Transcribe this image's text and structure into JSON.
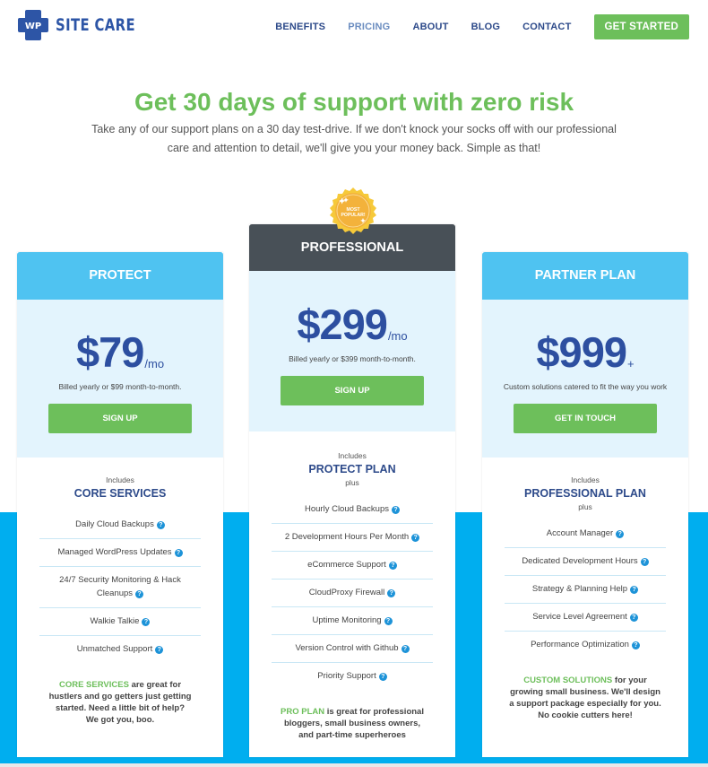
{
  "header": {
    "logo_mark": "WP",
    "logo_text": "SITE CARE",
    "nav": [
      {
        "label": "BENEFITS",
        "active": false
      },
      {
        "label": "PRICING",
        "active": true
      },
      {
        "label": "ABOUT",
        "active": false
      },
      {
        "label": "BLOG",
        "active": false
      },
      {
        "label": "CONTACT",
        "active": false
      }
    ],
    "cta_label": "GET STARTED"
  },
  "hero": {
    "title": "Get 30 days of support with zero risk",
    "subtitle": "Take any of our support plans on a 30 day test-drive. If we don't knock your socks off with our professional care and attention to detail, we'll give you your money back. Simple as that!"
  },
  "colors": {
    "brand_blue": "#2d55a6",
    "green": "#6dbf5b",
    "light_blue_head": "#4fc3f1",
    "dark_head": "#485057",
    "band_blue": "#00aeef",
    "badge_gold": "#f3b23b"
  },
  "badge": {
    "line1": "MOST",
    "line2": "POPULAR!"
  },
  "plans": [
    {
      "name": "PROTECT",
      "price": "$79",
      "per": "/mo",
      "billing": "Billed yearly or $99 month-to-month.",
      "button": "SIGN UP",
      "includes": "Includes",
      "includes_title": "CORE SERVICES",
      "plus": "",
      "features": [
        "Daily Cloud Backups",
        "Managed WordPress Updates",
        "24/7 Security Monitoring & Hack Cleanups",
        "Walkie Talkie",
        "Unmatched Support"
      ],
      "blurb_highlight": "CORE SERVICES",
      "blurb_rest": " are great for hustlers and go getters just getting started. Need a little bit of help? We got you, boo."
    },
    {
      "name": "PROFESSIONAL",
      "price": "$299",
      "per": "/mo",
      "billing": "Billed yearly or $399 month-to-month.",
      "button": "SIGN UP",
      "includes": "Includes",
      "includes_title": "PROTECT PLAN",
      "plus": "plus",
      "features": [
        "Hourly Cloud Backups",
        "2 Development Hours Per Month",
        "eCommerce Support",
        "CloudProxy Firewall",
        "Uptime Monitoring",
        "Version Control with Github",
        "Priority Support"
      ],
      "blurb_highlight": "PRO PLAN",
      "blurb_rest": " is great for professional bloggers, small business owners, and part-time superheroes"
    },
    {
      "name": "PARTNER PLAN",
      "price": "$999",
      "per": "+",
      "billing": "Custom solutions catered to fit the way you work",
      "button": "GET IN TOUCH",
      "includes": "Includes",
      "includes_title": "PROFESSIONAL PLAN",
      "plus": "plus",
      "features": [
        "Account Manager",
        "Dedicated Development Hours",
        "Strategy & Planning Help",
        "Service Level Agreement",
        "Performance Optimization"
      ],
      "blurb_highlight": "CUSTOM SOLUTIONS",
      "blurb_rest": " for your growing small business. We'll design a support package especially for you. No cookie cutters here!"
    }
  ],
  "help_icon_glyph": "?"
}
